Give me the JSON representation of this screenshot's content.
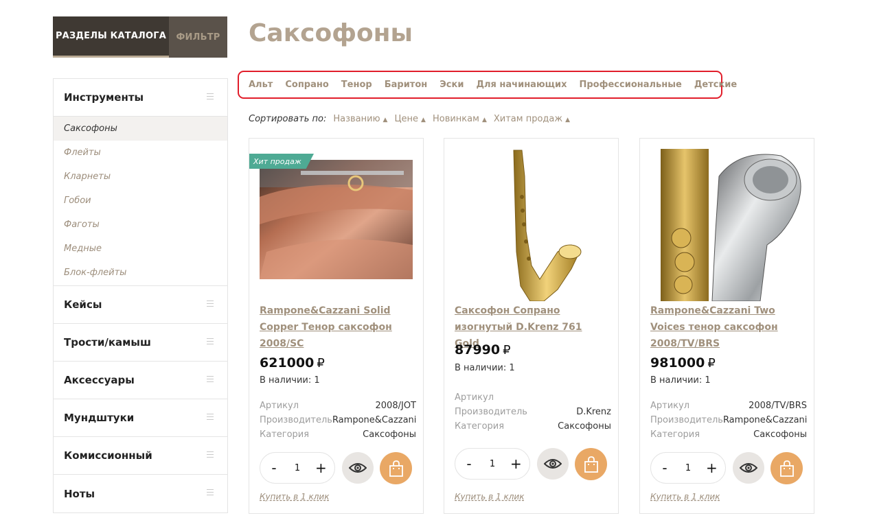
{
  "sidebar": {
    "tab_catalog": "РАЗДЕЛЫ КАТАЛОГА",
    "tab_filter": "ФИЛЬТР",
    "categories": [
      {
        "label": "Инструменты"
      },
      {
        "label": "Кейсы"
      },
      {
        "label": "Трости/камыш"
      },
      {
        "label": "Аксессуары"
      },
      {
        "label": "Мундштуки"
      },
      {
        "label": "Комиссионный"
      },
      {
        "label": "Ноты"
      }
    ],
    "subcategories": [
      "Саксофоны",
      "Флейты",
      "Кларнеты",
      "Гобои",
      "Фаготы",
      "Медные",
      "Блок-флейты"
    ]
  },
  "main": {
    "title": "Саксофоны",
    "subcats": [
      "Альт",
      "Сопрано",
      "Тенор",
      "Баритон",
      "Эски",
      "Для начинающих",
      "Профессиональные",
      "Детские"
    ],
    "sort": {
      "label": "Сортировать по:",
      "items": [
        "Названию",
        "Цене",
        "Новинкам",
        "Хитам продаж"
      ],
      "arrow": "▲"
    }
  },
  "products": [
    {
      "badge": "Хит продаж",
      "name": "Rampone&Cazzani Solid Copper Тенор саксофон 2008/SC",
      "price": "621000",
      "currency": "₽",
      "stock": "В наличии: 1",
      "props": [
        {
          "k": "Артикул",
          "v": "2008/JOT"
        },
        {
          "k": "Производитель",
          "v": "Rampone&Cazzani"
        },
        {
          "k": "Категория",
          "v": "Саксофоны"
        }
      ],
      "qty": "1",
      "minus": "-",
      "plus": "+",
      "buy_one_click": "Купить в 1 клик"
    },
    {
      "badge": "",
      "name": "Саксофон Сопрано изогнутый D.Krenz 761 Gold",
      "price": "87990",
      "currency": "₽",
      "stock": "В наличии: 1",
      "props": [
        {
          "k": "Артикул",
          "v": ""
        },
        {
          "k": "Производитель",
          "v": "D.Krenz"
        },
        {
          "k": "Категория",
          "v": "Саксофоны"
        }
      ],
      "qty": "1",
      "minus": "-",
      "plus": "+",
      "buy_one_click": "Купить в 1 клик"
    },
    {
      "badge": "",
      "name": "Rampone&Cazzani Two Voices тенор саксофон 2008/TV/BRS",
      "price": "981000",
      "currency": "₽",
      "stock": "В наличии: 1",
      "props": [
        {
          "k": "Артикул",
          "v": "2008/TV/BRS"
        },
        {
          "k": "Производитель",
          "v": "Rampone&Cazzani"
        },
        {
          "k": "Категория",
          "v": "Саксофоны"
        }
      ],
      "qty": "1",
      "minus": "-",
      "plus": "+",
      "buy_one_click": "Купить в 1 клик"
    }
  ],
  "colors": {
    "accent": "#a0907c",
    "highlight_border": "#e11d2a",
    "badge": "#4eaa94",
    "cart_button": "#e9a865"
  },
  "icons": {
    "menu": "burger-icon",
    "view": "eye-icon",
    "cart": "shopping-bag-icon"
  }
}
